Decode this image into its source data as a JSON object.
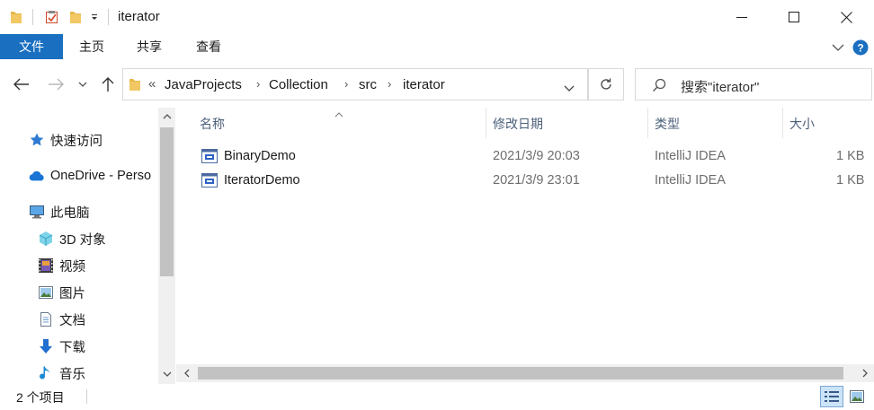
{
  "window": {
    "title": "iterator"
  },
  "ribbon": {
    "tabs": [
      "文件",
      "主页",
      "共享",
      "查看"
    ]
  },
  "address": {
    "overflow": "«",
    "crumbs": [
      "JavaProjects",
      "Collection",
      "src",
      "iterator"
    ]
  },
  "search": {
    "placeholder": "搜索\"iterator\""
  },
  "sidebar": {
    "items": [
      {
        "label": "快速访问",
        "icon": "star-icon"
      },
      {
        "label": "OneDrive - Perso",
        "icon": "cloud-icon"
      },
      {
        "label": "此电脑",
        "icon": "computer-icon"
      },
      {
        "label": "3D 对象",
        "icon": "cube-icon"
      },
      {
        "label": "视频",
        "icon": "film-icon"
      },
      {
        "label": "图片",
        "icon": "picture-icon"
      },
      {
        "label": "文档",
        "icon": "document-icon"
      },
      {
        "label": "下载",
        "icon": "download-arrow-icon"
      },
      {
        "label": "音乐",
        "icon": "music-note-icon"
      }
    ]
  },
  "columns": {
    "name": "名称",
    "date": "修改日期",
    "type": "类型",
    "size": "大小"
  },
  "files": [
    {
      "name": "BinaryDemo",
      "date": "2021/3/9 20:03",
      "type": "IntelliJ IDEA",
      "size": "1 KB"
    },
    {
      "name": "IteratorDemo",
      "date": "2021/3/9 23:01",
      "type": "IntelliJ IDEA",
      "size": "1 KB"
    }
  ],
  "status": {
    "count": "2 个项目"
  },
  "colors": {
    "accent": "#1a6fc0",
    "folder": "#e8b84a",
    "header_text": "#4c607a"
  }
}
